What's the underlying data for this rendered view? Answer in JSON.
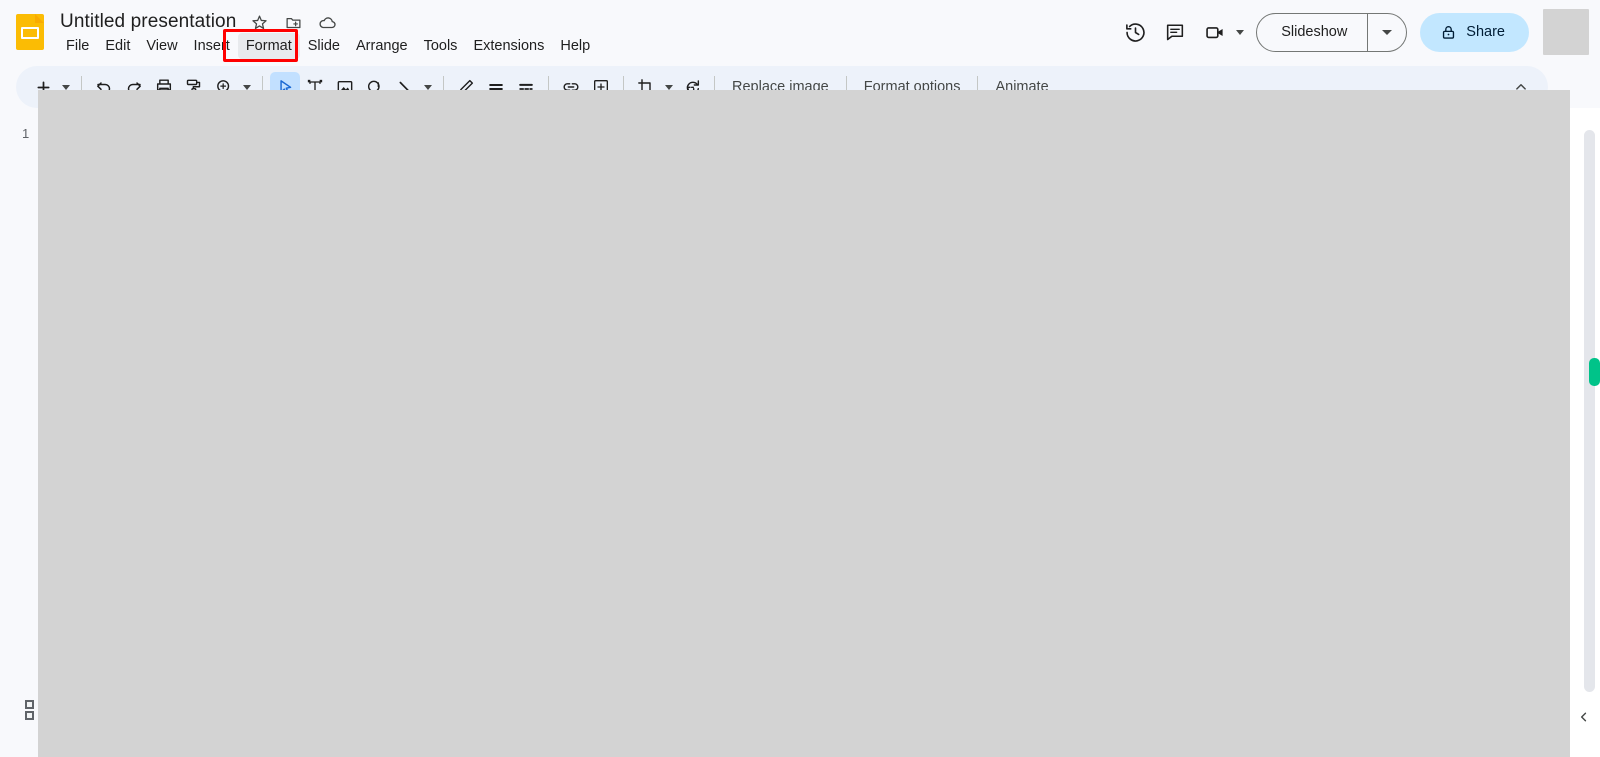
{
  "app": {
    "name": "Google Slides",
    "logo_icon": "slides-logo-icon"
  },
  "header": {
    "doc_title": "Untitled presentation",
    "title_icons": [
      {
        "name": "star-icon",
        "label": "Star"
      },
      {
        "name": "move-to-folder-icon",
        "label": "Move"
      },
      {
        "name": "cloud-saved-icon",
        "label": "See document status"
      }
    ],
    "menus": [
      {
        "label": "File",
        "active": false
      },
      {
        "label": "Edit",
        "active": false
      },
      {
        "label": "View",
        "active": false
      },
      {
        "label": "Insert",
        "active": false
      },
      {
        "label": "Format",
        "active": true
      },
      {
        "label": "Slide",
        "active": false
      },
      {
        "label": "Arrange",
        "active": false
      },
      {
        "label": "Tools",
        "active": false
      },
      {
        "label": "Extensions",
        "active": false
      },
      {
        "label": "Help",
        "active": false
      }
    ],
    "right_icons": [
      {
        "name": "version-history-icon",
        "label": "Last edit was seconds ago"
      },
      {
        "name": "comment-icon",
        "label": "Open comment history"
      },
      {
        "name": "present-video-icon",
        "label": "Join a call"
      }
    ],
    "slideshow": {
      "label": "Slideshow",
      "dropdown_icon": "chevron-down-icon"
    },
    "share": {
      "label": "Share",
      "lock_icon": "lock-icon",
      "background": "#c2e7ff"
    },
    "avatar": {
      "name": "account-avatar",
      "color": "#d3d3d3"
    }
  },
  "toolbar": {
    "icons": [
      {
        "name": "new-slide-icon",
        "label": "New slide",
        "selected": false,
        "has_caret": true
      },
      {
        "name": "undo-icon",
        "label": "Undo",
        "selected": false,
        "has_caret": false
      },
      {
        "name": "redo-icon",
        "label": "Redo",
        "selected": false,
        "has_caret": false
      },
      {
        "name": "print-icon",
        "label": "Print",
        "selected": false,
        "has_caret": false
      },
      {
        "name": "paint-format-icon",
        "label": "Paint format",
        "selected": false,
        "has_caret": false
      },
      {
        "name": "zoom-icon",
        "label": "Zoom",
        "selected": false,
        "has_caret": true
      },
      {
        "name": "select-tool-icon",
        "label": "Select",
        "selected": true,
        "has_caret": false
      },
      {
        "name": "text-box-icon",
        "label": "Text box",
        "selected": false,
        "has_caret": false
      },
      {
        "name": "insert-image-icon",
        "label": "Insert image",
        "selected": false,
        "has_caret": false
      },
      {
        "name": "shape-icon",
        "label": "Shape",
        "selected": false,
        "has_caret": false
      },
      {
        "name": "line-icon",
        "label": "Line",
        "selected": false,
        "has_caret": true
      },
      {
        "name": "line-color-icon",
        "label": "Line color",
        "selected": false,
        "has_caret": false
      },
      {
        "name": "line-weight-icon",
        "label": "Line weight",
        "selected": false,
        "has_caret": false
      },
      {
        "name": "line-dash-icon",
        "label": "Line dash",
        "selected": false,
        "has_caret": false
      },
      {
        "name": "insert-link-icon",
        "label": "Insert link",
        "selected": false,
        "has_caret": false
      },
      {
        "name": "add-comment-icon",
        "label": "Add comment",
        "selected": false,
        "has_caret": false
      },
      {
        "name": "crop-image-icon",
        "label": "Crop image",
        "selected": false,
        "has_caret": true
      },
      {
        "name": "mask-image-icon",
        "label": "Mask image",
        "selected": false,
        "has_caret": false
      }
    ],
    "text_buttons": [
      {
        "label": "Replace image"
      },
      {
        "label": "Format options"
      },
      {
        "label": "Animate"
      }
    ],
    "collapse_icon": "chevron-up-icon",
    "background": "#edf2fa"
  },
  "filmstrip": {
    "slide_number": "1",
    "drag_handle_icon": "panel-resize-handle-icon"
  },
  "canvas": {
    "overlay_color": "#d3d3d3",
    "scrollbar": {
      "name": "vertical-scrollbar",
      "color": "#e4e6eb"
    },
    "presence_marker": {
      "name": "collaborator-presence-marker",
      "color": "#00c389"
    },
    "expand_panel_icon": "chevron-left-icon"
  },
  "annotation": {
    "target": "Format",
    "box_color": "#ff0000"
  }
}
